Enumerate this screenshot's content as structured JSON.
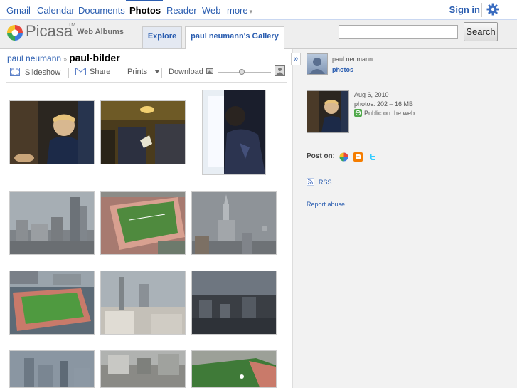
{
  "topbar": {
    "links": [
      "Gmail",
      "Calendar",
      "Documents",
      "Photos",
      "Reader",
      "Web",
      "more"
    ],
    "selected": "Photos",
    "more_arrow": "▾",
    "sign_in": "Sign in",
    "settings_icon": "gear-icon"
  },
  "header": {
    "logo_text": "Picasa",
    "logo_tm": "TM",
    "logo_sub": "Web Albums",
    "tabs": [
      "Explore",
      "paul neumann's Gallery"
    ],
    "search_value": "",
    "search_button": "Search"
  },
  "breadcrumb": {
    "user": "paul neumann",
    "separator": "»",
    "album": "paul-bilder"
  },
  "toolbar": {
    "slideshow": "Slideshow",
    "share": "Share",
    "prints": "Prints",
    "download": "Download",
    "zoom_level": 0.45
  },
  "sidebar": {
    "expander": "»",
    "owner_name": "paul neumann",
    "owner_link": "photos",
    "album_date": "Aug 6, 2010",
    "album_stats": "photos: 202 – 16 MB",
    "visibility": "Public on the web",
    "post_on": "Post on:",
    "rss": "RSS",
    "report_abuse": "Report abuse"
  },
  "colors": {
    "link": "#2a5db0",
    "header_bg": "#eeeeee",
    "sidebar_bg": "#f2f2f2"
  }
}
